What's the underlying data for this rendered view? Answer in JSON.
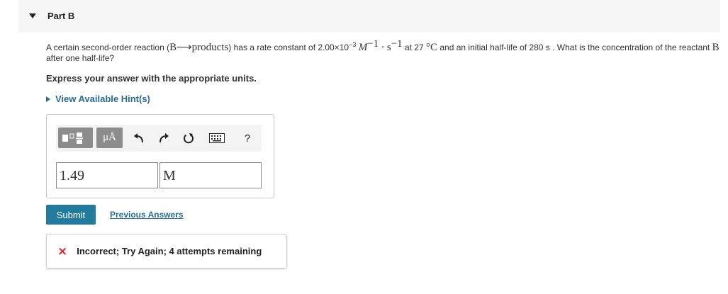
{
  "part": {
    "title": "Part B"
  },
  "question": {
    "text_1": "A certain second-order reaction (",
    "reaction_B": "B",
    "reaction_arrow": "⟶",
    "reaction_products": "products",
    "text_2": ") has a rate constant of 2.00×10",
    "rate_exp": "−3",
    "unit_M": "M",
    "unit_M_exp": "−1",
    "unit_dot": "·",
    "unit_s": "s",
    "unit_s_exp": "−1",
    "text_3": " at 27 ",
    "temp_unit": "°C",
    "text_4": " and an initial half-life of 280 s . What is the concentration of the reactant ",
    "reactant": "B",
    "text_5": " after one half-life?"
  },
  "instructions": "Express your answer with the appropriate units.",
  "hint_link": "View Available Hint(s)",
  "toolbar": {
    "unit_button_label": "μÅ",
    "help_label": "?"
  },
  "answer": {
    "value": "1.49",
    "units": "M"
  },
  "submit_label": "Submit",
  "previous_answers_label": "Previous Answers",
  "feedback": {
    "icon": "×",
    "text": "Incorrect; Try Again; 4 attempts remaining"
  },
  "colors": {
    "accent": "#227b9c",
    "link": "#2b6b94",
    "error": "#d9272e",
    "toolbar_button": "#8c8c8c"
  }
}
